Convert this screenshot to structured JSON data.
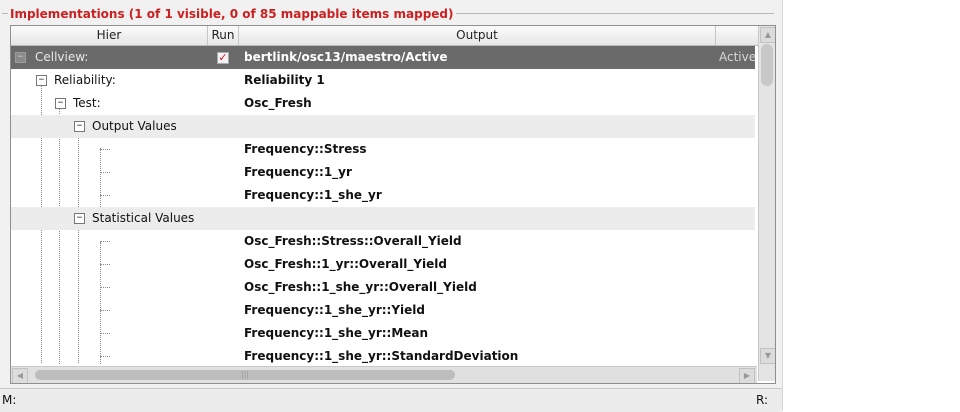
{
  "group": {
    "title": "Implementations (1 of 1 visible, 0 of 85 mappable items mapped)"
  },
  "columns": {
    "hier": "Hier",
    "run": "Run",
    "output": "Output"
  },
  "rows": {
    "cellview": {
      "label": "Cellview:",
      "output": "bertlink/osc13/maestro/Active",
      "state": "Active",
      "run_checked": true
    },
    "reliability": {
      "label": "Reliability:",
      "output": "Reliability 1"
    },
    "test": {
      "label": "Test:",
      "output": "Osc_Fresh"
    },
    "output_values": {
      "label": "Output Values"
    },
    "ov_items": [
      "Frequency::Stress",
      "Frequency::1_yr",
      "Frequency::1_she_yr"
    ],
    "statistical_values": {
      "label": "Statistical Values"
    },
    "sv_items": [
      "Osc_Fresh::Stress::Overall_Yield",
      "Osc_Fresh::1_yr::Overall_Yield",
      "Osc_Fresh::1_she_yr::Overall_Yield",
      "Frequency::1_she_yr::Yield",
      "Frequency::1_she_yr::Mean",
      "Frequency::1_she_yr::StandardDeviation"
    ]
  },
  "icons": {
    "expand_collapse": "minus-box-icon",
    "checkbox": "checkmark-icon",
    "scroll_up": "arrow-up-icon",
    "scroll_down": "arrow-down-icon",
    "scroll_left": "arrow-left-icon",
    "scroll_right": "arrow-right-icon"
  },
  "colors": {
    "title": "#cc2020",
    "selected_row": "#6a6a6a",
    "check": "#d01818"
  },
  "status": {
    "left": "M:",
    "right": "R:"
  }
}
